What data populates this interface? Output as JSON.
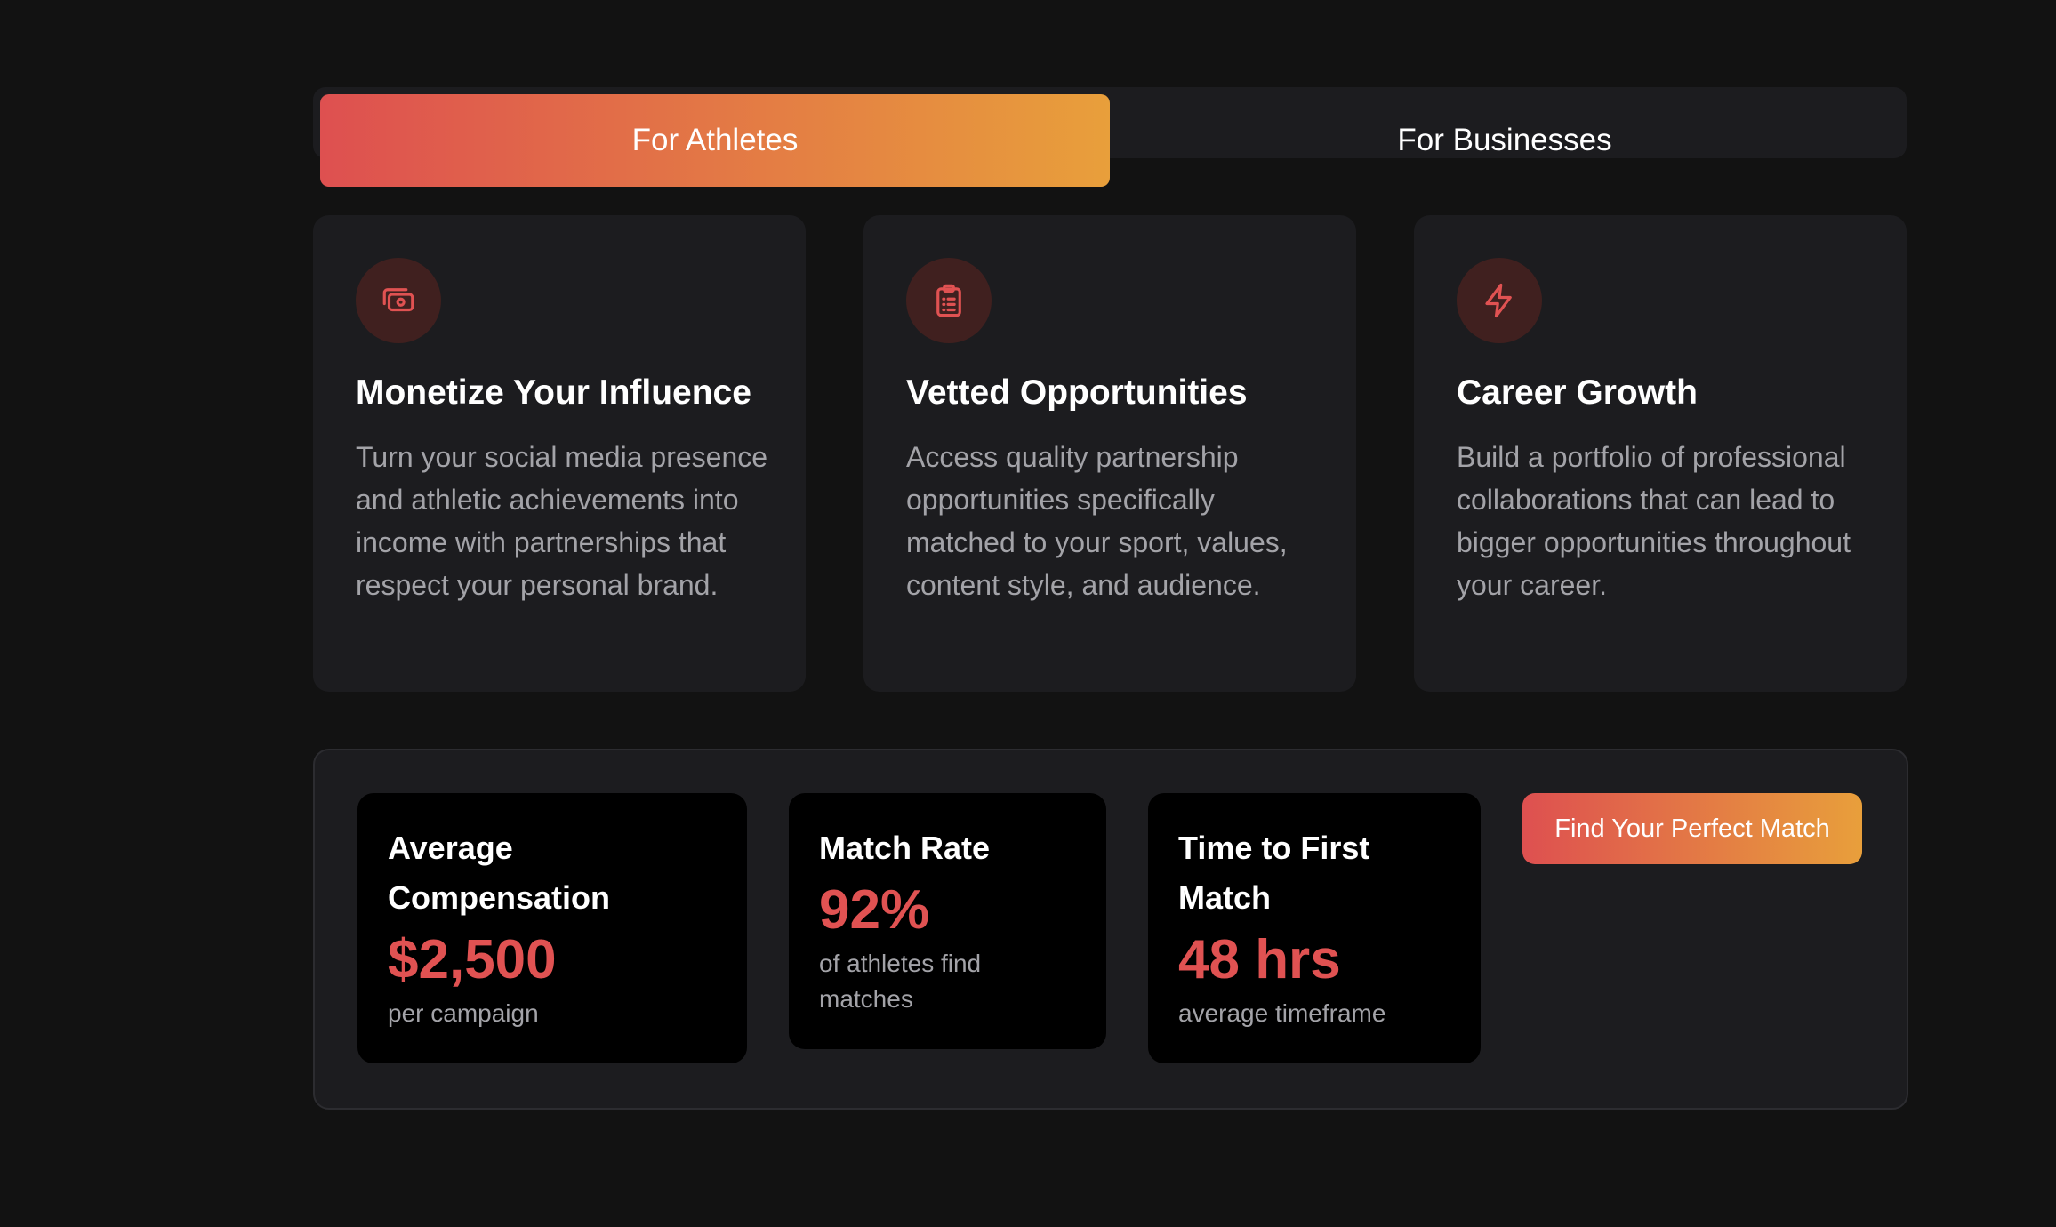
{
  "tabs": [
    {
      "label": "For Athletes",
      "active": true
    },
    {
      "label": "For Businesses",
      "active": false
    }
  ],
  "colors": {
    "accent_start": "#de5050",
    "accent_end": "#e89f3b",
    "stat_value": "#e05252",
    "background": "#121212",
    "card": "#1c1c1f"
  },
  "features": [
    {
      "icon": "money-icon",
      "title": "Monetize Your Influence",
      "description": "Turn your social media presence and athletic achievements into income with partnerships that respect your personal brand."
    },
    {
      "icon": "clipboard-list-icon",
      "title": "Vetted Opportunities",
      "description": "Access quality partnership opportunities specifically matched to your sport, values, content style, and audience."
    },
    {
      "icon": "lightning-bolt-icon",
      "title": "Career Growth",
      "description": "Build a portfolio of professional collaborations that can lead to bigger opportunities throughout your career."
    }
  ],
  "stats": [
    {
      "label_line1": "Average",
      "label_line2": "Compensation",
      "value": "$2,500",
      "sub": "per campaign"
    },
    {
      "label_line1": "Match Rate",
      "value": "92%",
      "sub_line1": "of athletes find",
      "sub_line2": "matches"
    },
    {
      "label_line1": "Time to First",
      "label_line2": "Match",
      "value": "48 hrs",
      "sub": "average timeframe"
    }
  ],
  "cta": {
    "label": "Find Your Perfect Match"
  }
}
